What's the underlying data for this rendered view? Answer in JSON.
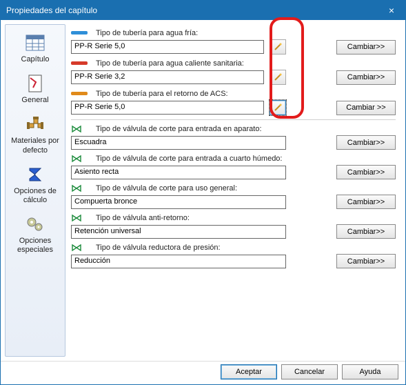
{
  "window": {
    "title": "Propiedades del capítulo",
    "close_label": "×"
  },
  "sidebar": {
    "items": [
      {
        "label": "Capítulo"
      },
      {
        "label": "General"
      },
      {
        "label": "Materiales por defecto"
      },
      {
        "label": "Opciones de cálculo"
      },
      {
        "label": "Opciones especiales"
      }
    ]
  },
  "pipes": [
    {
      "label": "Tipo de tubería para agua fría:",
      "value": "PP-R Serie 5,0",
      "change": "Cambiar>>",
      "icon_color": "#2f8fd8"
    },
    {
      "label": "Tipo de tubería para agua caliente sanitaria:",
      "value": "PP-R Serie 3,2",
      "change": "Cambiar>>",
      "icon_color": "#d63a2a"
    },
    {
      "label": "Tipo de tubería para el retorno de ACS:",
      "value": "PP-R Serie 5,0",
      "change": "Cambiar >>",
      "icon_color": "#e08a1a"
    }
  ],
  "valves": [
    {
      "label": "Tipo de válvula de corte para entrada en aparato:",
      "value": "Escuadra",
      "change": "Cambiar>>"
    },
    {
      "label": "Tipo de válvula de corte para entrada a cuarto húmedo:",
      "value": "Asiento recta",
      "change": "Cambiar>>"
    },
    {
      "label": "Tipo de válvula de corte para uso general:",
      "value": "Compuerta bronce",
      "change": "Cambiar>>"
    },
    {
      "label": "Tipo de válvula anti-retorno:",
      "value": "Retención universal",
      "change": "Cambiar>>"
    },
    {
      "label": "Tipo de válvula reductora de presión:",
      "value": "Reducción",
      "change": "Cambiar>>"
    }
  ],
  "footer": {
    "accept": "Aceptar",
    "cancel": "Cancelar",
    "help": "Ayuda"
  }
}
